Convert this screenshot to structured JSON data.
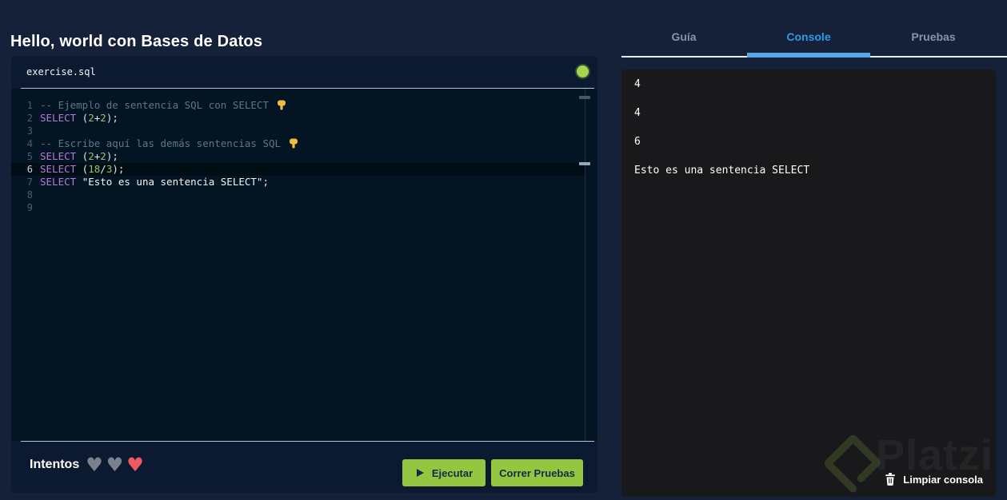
{
  "header": {
    "title": "Hello, world con Bases de Datos"
  },
  "editor": {
    "filename": "exercise.sql",
    "status_dot": "ready",
    "active_line": 6,
    "lines": [
      {
        "n": 1,
        "tokens": [
          {
            "t": "comment",
            "v": "-- Ejemplo de sentencia SQL con SELECT "
          },
          {
            "t": "emoji",
            "icon": "backhand-index-pointing-down",
            "v": "👇"
          }
        ]
      },
      {
        "n": 2,
        "tokens": [
          {
            "t": "keyword",
            "v": "SELECT"
          },
          {
            "t": "plain",
            "v": " ("
          },
          {
            "t": "number",
            "v": "2"
          },
          {
            "t": "plain",
            "v": "+"
          },
          {
            "t": "number",
            "v": "2"
          },
          {
            "t": "plain",
            "v": ");"
          }
        ]
      },
      {
        "n": 3,
        "tokens": []
      },
      {
        "n": 4,
        "tokens": [
          {
            "t": "comment",
            "v": "-- Escribe aquí las demás sentencias SQL "
          },
          {
            "t": "emoji",
            "icon": "backhand-index-pointing-down",
            "v": "👇"
          }
        ]
      },
      {
        "n": 5,
        "tokens": [
          {
            "t": "keyword",
            "v": "SELECT"
          },
          {
            "t": "plain",
            "v": " ("
          },
          {
            "t": "number",
            "v": "2"
          },
          {
            "t": "plain",
            "v": "+"
          },
          {
            "t": "number",
            "v": "2"
          },
          {
            "t": "plain",
            "v": ");"
          }
        ]
      },
      {
        "n": 6,
        "tokens": [
          {
            "t": "keyword",
            "v": "SELECT"
          },
          {
            "t": "plain",
            "v": " ("
          },
          {
            "t": "number",
            "v": "18"
          },
          {
            "t": "plain",
            "v": "/"
          },
          {
            "t": "number",
            "v": "3"
          },
          {
            "t": "plain",
            "v": ");"
          }
        ]
      },
      {
        "n": 7,
        "tokens": [
          {
            "t": "keyword",
            "v": "SELECT"
          },
          {
            "t": "plain",
            "v": " "
          },
          {
            "t": "string",
            "v": "\"Esto es una sentencia SELECT\""
          },
          {
            "t": "plain",
            "v": ";"
          }
        ]
      },
      {
        "n": 8,
        "tokens": []
      },
      {
        "n": 9,
        "tokens": []
      }
    ],
    "footer": {
      "attempts_label": "Intentos",
      "hearts": [
        "spent",
        "spent",
        "remaining"
      ],
      "run_label": "Ejecutar",
      "tests_label": "Correr Pruebas"
    }
  },
  "tabs": [
    {
      "label": "Guía",
      "active": false
    },
    {
      "label": "Console",
      "active": true
    },
    {
      "label": "Pruebas",
      "active": false
    }
  ],
  "console": {
    "lines": [
      "4",
      "4",
      "6",
      "Esto es una sentencia SELECT"
    ],
    "clear_label": "Limpiar consola",
    "watermark": "Platzi"
  },
  "colors": {
    "accent_blue": "#2f9ae8",
    "tab_indicator": "#55a9e6",
    "button_green": "#93c73f",
    "button_text": "#152a49",
    "heart_red": "#ee5a60",
    "heart_gray": "#7b818c",
    "status_dot_green": "#a6d64d",
    "keyword_purple": "#b878dc",
    "number_green": "#8cc765",
    "comment_gray": "#5b7888",
    "page_bg": "#152039",
    "editor_bg": "#031523",
    "console_bg": "#19191b"
  }
}
